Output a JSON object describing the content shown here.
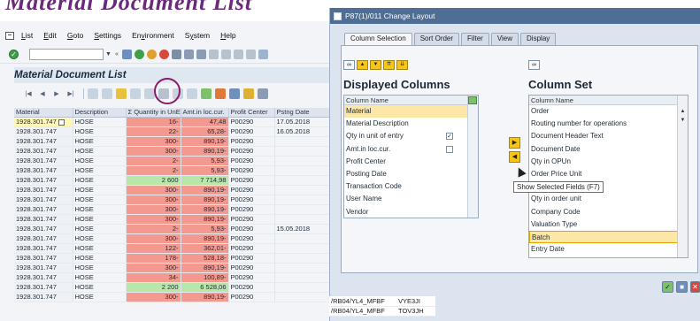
{
  "banner": {
    "text": "Material Document List"
  },
  "menu": {
    "items": [
      "List",
      "Edit",
      "Goto",
      "Settings",
      "Environment",
      "System",
      "Help"
    ],
    "underline": [
      "L",
      "E",
      "G",
      "S",
      "v",
      "y",
      "H"
    ]
  },
  "page": {
    "title": "Material Document List"
  },
  "grid": {
    "headers": [
      "Material",
      "Description",
      "Σ Quantity in UnE",
      "Amt.in loc.cur.",
      "Profit Center",
      "Pstng Date"
    ],
    "rows": [
      [
        "1928.301.747",
        "HOSE",
        "16-",
        "47,48",
        "P00290",
        "17.05.2018"
      ],
      [
        "1928.301.747",
        "HOSE",
        "22-",
        "65,28-",
        "P00290",
        "16.05.2018"
      ],
      [
        "1928.301.747",
        "HOSE",
        "300-",
        "890,19-",
        "P00290",
        ""
      ],
      [
        "1928.301.747",
        "HOSE",
        "300-",
        "890,19-",
        "P00290",
        ""
      ],
      [
        "1928.301.747",
        "HOSE",
        "2-",
        "5,93-",
        "P00290",
        ""
      ],
      [
        "1928.301.747",
        "HOSE",
        "2-",
        "5,93-",
        "P00290",
        ""
      ],
      [
        "1928.301.747",
        "HOSE",
        "2 600",
        "7 714,98",
        "P00290",
        ""
      ],
      [
        "1928.301.747",
        "HOSE",
        "300-",
        "890,19-",
        "P00290",
        ""
      ],
      [
        "1928.301.747",
        "HOSE",
        "300-",
        "890,19-",
        "P00290",
        ""
      ],
      [
        "1928.301.747",
        "HOSE",
        "300-",
        "890,19-",
        "P00290",
        ""
      ],
      [
        "1928.301.747",
        "HOSE",
        "300-",
        "890,19-",
        "P00290",
        ""
      ],
      [
        "1928.301.747",
        "HOSE",
        "2-",
        "5,93-",
        "P00290",
        "15.05.2018"
      ],
      [
        "1928.301.747",
        "HOSE",
        "300-",
        "890,19-",
        "P00290",
        ""
      ],
      [
        "1928.301.747",
        "HOSE",
        "122-",
        "362,01-",
        "P00290",
        ""
      ],
      [
        "1928.301.747",
        "HOSE",
        "178-",
        "528,18-",
        "P00290",
        ""
      ],
      [
        "1928.301.747",
        "HOSE",
        "300-",
        "890,19-",
        "P00290",
        ""
      ],
      [
        "1928.301.747",
        "HOSE",
        "34-",
        "100,89-",
        "P00290",
        ""
      ],
      [
        "1928.301.747",
        "HOSE",
        "2 200",
        "6 528,06",
        "P00290",
        ""
      ],
      [
        "1928.301.747",
        "HOSE",
        "300-",
        "890,19-",
        "P00290",
        ""
      ]
    ],
    "colors": {
      "negative": "#f4998f",
      "positive": "#b9e6a9"
    }
  },
  "dialog": {
    "title": "P87(1)/011 Change Layout",
    "tabs": [
      "Column Selection",
      "Sort Order",
      "Filter",
      "View",
      "Display"
    ],
    "displayed": {
      "title": "Displayed Columns",
      "header": "Column Name",
      "items": [
        "Material",
        "Material Description",
        "Qty in unit of entry",
        "Amt.in loc.cur.",
        "Profit Center",
        "Posting Date",
        "Transaction Code",
        "User Name",
        "Vendor"
      ],
      "checked": [
        false,
        false,
        true,
        false,
        false,
        false,
        false,
        false,
        false
      ],
      "has_checkbox": [
        false,
        false,
        true,
        true,
        false,
        false,
        false,
        false,
        false
      ]
    },
    "column_set": {
      "title": "Column Set",
      "header": "Column Name",
      "items": [
        "Order",
        "Routing number for operations",
        "Document Header Text",
        "Document Date",
        "Qty in OPUn",
        "Order Price Unit",
        "",
        "Qty in order unit",
        "Company Code",
        "Valuation Type",
        "Batch",
        "Entry Date"
      ]
    },
    "tooltip": "Show Selected Fields  (F7)"
  },
  "bottom_rows": [
    [
      "/RB04/YL4_MFBF",
      "VYE3JI"
    ],
    [
      "/RB04/YL4_MFBF",
      "TOV3JH"
    ]
  ],
  "colors": {
    "accent": "#4f6e95",
    "highlight": "#8b1a6b",
    "selection": "#fde7a6"
  }
}
